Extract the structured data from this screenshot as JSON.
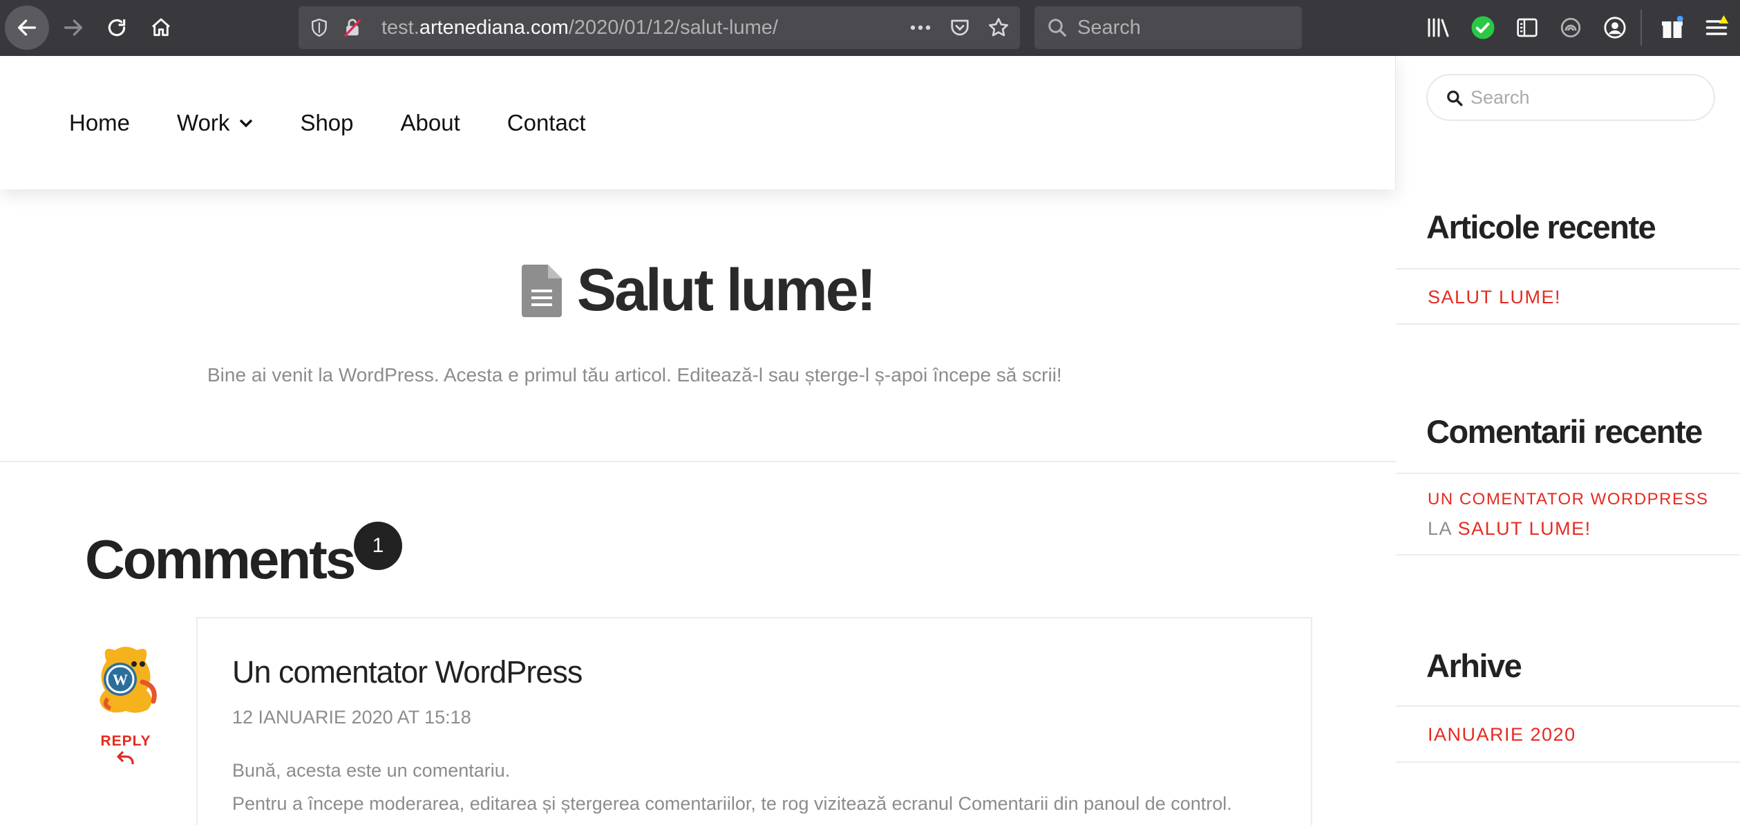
{
  "browser": {
    "url_prefix": "test.",
    "url_domain": "artenediana.com",
    "url_path": "/2020/01/12/salut-lume/",
    "search_placeholder": "Search"
  },
  "nav": {
    "items": [
      {
        "label": "Home"
      },
      {
        "label": "Work"
      },
      {
        "label": "Shop"
      },
      {
        "label": "About"
      },
      {
        "label": "Contact"
      }
    ]
  },
  "post": {
    "title": "Salut lume!",
    "excerpt": "Bine ai venit la WordPress. Acesta e primul tău articol. Editează-l sau șterge-l ș-apoi începe să scrii!"
  },
  "comments": {
    "heading": "Comments",
    "count": "1",
    "items": [
      {
        "author": "Un comentator WordPress",
        "date": "12 IANUARIE 2020 AT 15:18",
        "reply_label": "REPLY",
        "lines": [
          "Bună, acesta este un comentariu.",
          "Pentru a începe moderarea, editarea și ștergerea comentariilor, te rog vizitează ecranul Comentarii din panoul de control."
        ]
      }
    ]
  },
  "sidebar": {
    "search_placeholder": "Search",
    "recent_posts": {
      "title": "Articole recente",
      "items": [
        "SALUT LUME!"
      ]
    },
    "recent_comments": {
      "title": "Comentarii recente",
      "author": "UN COMENTATOR WORDPRESS",
      "connector": "LA",
      "post": "SALUT LUME!"
    },
    "archives": {
      "title": "Arhive",
      "items": [
        "IANUARIE 2020"
      ]
    }
  },
  "colors": {
    "accent": "#e52b20",
    "chrome": "#38383d",
    "text": "#222222",
    "muted": "#8c8c8c"
  }
}
